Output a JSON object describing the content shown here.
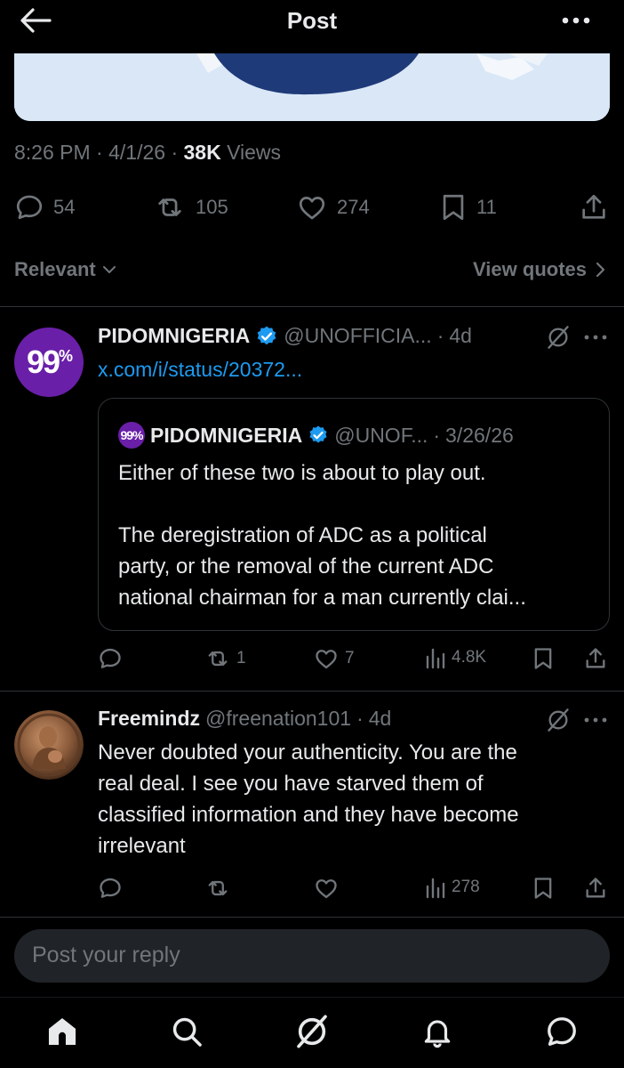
{
  "header": {
    "title": "Post"
  },
  "post": {
    "time": "8:26 PM",
    "date": "4/1/26",
    "views_count": "38K",
    "views_label": "Views",
    "actions": {
      "replies": "54",
      "reposts": "105",
      "likes": "274",
      "bookmarks": "11"
    }
  },
  "sort": {
    "label": "Relevant",
    "view_quotes": "View quotes"
  },
  "reply1": {
    "avatar_text": "99",
    "avatar_sup": "%",
    "name": "PIDOMNIGERIA",
    "handle": "@UNOFFICIA...",
    "time": "4d",
    "link": "x.com/i/status/20372...",
    "quote": {
      "avatar_text": "99%",
      "name": "PIDOMNIGERIA",
      "handle": "@UNOF...",
      "date": "3/26/26",
      "line1": "Either of these two is about to play out.",
      "line2": "The deregistration of ADC as a political",
      "line3": "party, or the removal of the current ADC",
      "line4": "national chairman for a man currently clai..."
    },
    "actions": {
      "reposts": "1",
      "likes": "7",
      "views": "4.8K"
    }
  },
  "reply2": {
    "name": "Freemindz",
    "handle": "@freenation101",
    "time": "4d",
    "line1": "Never doubted your authenticity. You are the",
    "line2": "real deal. I see you have starved them of",
    "line3": "classified information and they have become",
    "line4": "irrelevant",
    "actions": {
      "views": "278"
    }
  },
  "reply_input": {
    "placeholder": "Post your reply"
  },
  "colors": {
    "accent": "#1d9bf0",
    "muted": "#71767b",
    "brand_avatar": "#6a1fa8"
  }
}
